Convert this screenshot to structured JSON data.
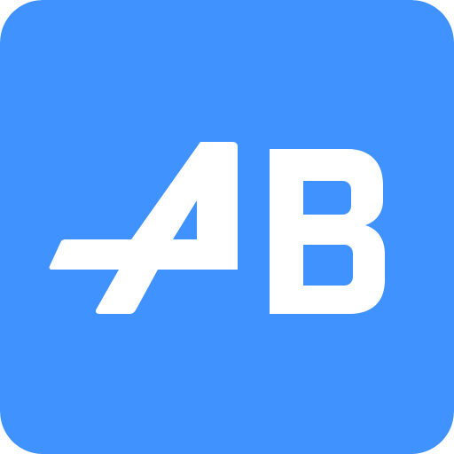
{
  "icon": {
    "name": "AB app icon",
    "logo_text": "AB",
    "colors": {
      "background": "#3f92ff",
      "glyph": "#ffffff"
    }
  }
}
